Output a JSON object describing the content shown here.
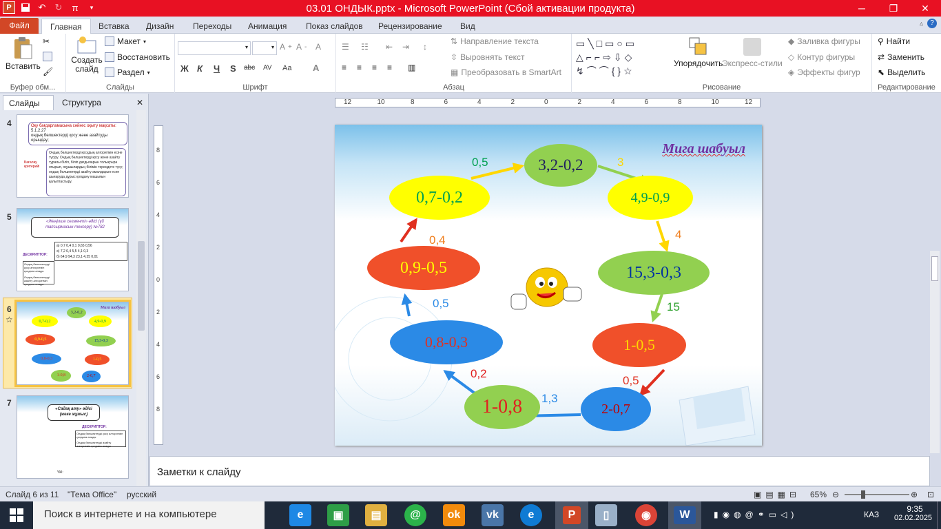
{
  "window": {
    "title": "03.01 ОНДЫК.pptx - Microsoft PowerPoint (Сбой активации продукта)",
    "app_letter": "P",
    "pi_symbol": "π"
  },
  "tabs": [
    "Файл",
    "Главная",
    "Вставка",
    "Дизайн",
    "Переходы",
    "Анимация",
    "Показ слайдов",
    "Рецензирование",
    "Вид"
  ],
  "ribbon": {
    "clipboard": {
      "label": "Буфер обм...",
      "paste": "Вставить"
    },
    "slides": {
      "label": "Слайды",
      "new_slide": "Создать слайд",
      "layout": "Макет",
      "reset": "Восстановить",
      "section": "Раздел"
    },
    "font": {
      "label": "Шрифт",
      "bold": "Ж",
      "italic": "К",
      "underline": "Ч",
      "shadow": "S",
      "strike": "abc",
      "spacing": "AV",
      "case": "Aa"
    },
    "paragraph": {
      "label": "Абзац",
      "text_dir": "Направление текста",
      "align_text": "Выровнять текст",
      "smartart": "Преобразовать в SmartArt"
    },
    "drawing": {
      "label": "Рисование",
      "arrange": "Упорядочить",
      "quick_styles": "Экспресс-стили",
      "fill": "Заливка фигуры",
      "outline": "Контур фигуры",
      "effects": "Эффекты фигур"
    },
    "editing": {
      "label": "Редактирование",
      "find": "Найти",
      "replace": "Заменить",
      "select": "Выделить"
    }
  },
  "left_panel": {
    "tab_slides": "Слайды",
    "tab_outline": "Структура",
    "thumbs": [
      {
        "num": "4",
        "title": "Оқу бағдарламасына сәйкес оқыту мақсаты:",
        "code": "5.1.2.27",
        "line": "ондық бөлшектерді қосу және азайтуды орындау;",
        "side": "Бағалау критерийі",
        "body": "Ондық бөлшектерді қосудың алгоритмін есіне түсіру. Ондық бөлшектерді қосу және азайту туралы біліп, біліп дағдыларын толықтыра отырып, оқушылардың білімін тереңдете түсу; ондық бөлшектерді азайту амалдарын есеп шығаруда дұрыс қолдану машығын қалыптастыру."
      },
      {
        "num": "5",
        "title": "«Жеңілше сегменті» әдісі (үй тапсырмасын тексеру) №782",
        "desc": "ДЕСКРИПТОР:",
        "rows": [
          "а) 0,7   0,4   0,1   0,65   0,56",
          "ә) 7,2   6,4   5,5   4,1   0,3",
          "б) 64,9   94,3   23,1   4,25   0,01"
        ],
        "d1": "Ондық бөлшектерді қосу алгоритмін қолдана алады",
        "d2": "Ондық бөлшектерді азайту алгоритмін қолдана алады"
      },
      {
        "num": "6",
        "star": "☆"
      },
      {
        "num": "7",
        "title": "«Садақ ату» әдісі (жеке жұмыс)",
        "desc": "ДЕСКРИПТОР:",
        "d1": "Ондық бөлшектерді қосу алгоритмін қолдана алады",
        "d2": "Ондық бөлшектерді азайту алгоритмін қолдана алады",
        "footer": "ҮЖ:"
      }
    ]
  },
  "ruler": {
    "h_labels": [
      "12",
      "10",
      "8",
      "6",
      "4",
      "2",
      "0",
      "2",
      "4",
      "6",
      "8",
      "10",
      "12"
    ],
    "v_labels": [
      "8",
      "6",
      "4",
      "2",
      "0",
      "2",
      "4",
      "6",
      "8"
    ]
  },
  "slide": {
    "title": "Мига шабуыл",
    "nodes": [
      {
        "id": "n1",
        "text": "3,2-0,2",
        "bg": "#92d050",
        "fg": "#1f1f5e"
      },
      {
        "id": "n2",
        "text": "4,9-0,9",
        "bg": "#ffff00",
        "fg": "#00a050"
      },
      {
        "id": "n3",
        "text": "15,3-0,3",
        "bg": "#92d050",
        "fg": "#0033a0"
      },
      {
        "id": "n4",
        "text": "1-0,5",
        "bg": "#f0502a",
        "fg": "#ffd700"
      },
      {
        "id": "n5",
        "text": "2-0,7",
        "bg": "#2b8ae6",
        "fg": "#c00000"
      },
      {
        "id": "n6",
        "text": "1-0,8",
        "bg": "#92d050",
        "fg": "#e02020"
      },
      {
        "id": "n7",
        "text": "0,8-0,3",
        "bg": "#2b8ae6",
        "fg": "#e03020"
      },
      {
        "id": "n8",
        "text": "0,9-0,5",
        "bg": "#f0502a",
        "fg": "#ffff00"
      },
      {
        "id": "n9",
        "text": "0,7-0,2",
        "bg": "#ffff00",
        "fg": "#00a050"
      }
    ],
    "answers": [
      {
        "text": "0,5",
        "color": "#00a050"
      },
      {
        "text": "3",
        "color": "#ffd700"
      },
      {
        "text": "4",
        "color": "#f08020"
      },
      {
        "text": "15",
        "color": "#2ca02c"
      },
      {
        "text": "0,5",
        "color": "#e03020"
      },
      {
        "text": "1,3",
        "color": "#2b8ae6"
      },
      {
        "text": "0,2",
        "color": "#e02020"
      },
      {
        "text": "0,5",
        "color": "#2b8ae6"
      },
      {
        "text": "0,4",
        "color": "#f08020"
      }
    ]
  },
  "notes_placeholder": "Заметки к слайду",
  "status": {
    "slide_info": "Слайд 6 из 11",
    "theme": "\"Тема Office\"",
    "lang": "русский",
    "zoom": "65%"
  },
  "taskbar": {
    "search": "Поиск в интернете и на компьютере",
    "lang": "КАЗ",
    "time": "9:35",
    "date": "02.02.2025"
  }
}
